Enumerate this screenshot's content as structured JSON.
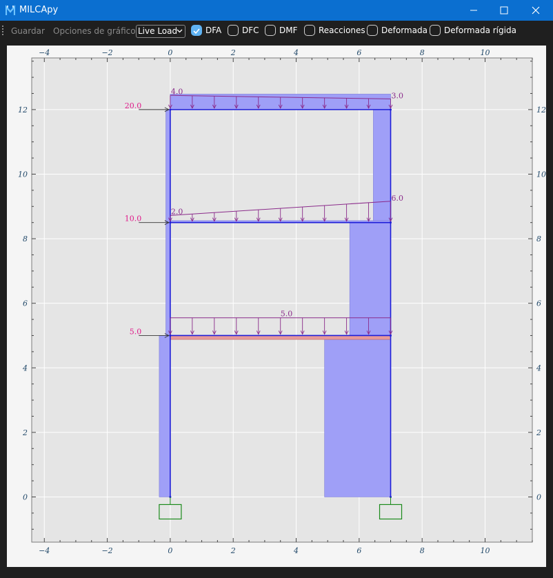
{
  "window": {
    "title": "MILCApy",
    "app_icon": "milca-logo-icon",
    "controls": [
      "minimize-icon",
      "maximize-icon",
      "close-icon"
    ]
  },
  "toolbar": {
    "save_label": "Guardar",
    "chart_options_label": "Opciones de gráfico",
    "load_case": {
      "selected": "Live Load"
    },
    "checkboxes": [
      {
        "label": "DFA",
        "checked": true
      },
      {
        "label": "DFC",
        "checked": false
      },
      {
        "label": "DMF",
        "checked": false
      },
      {
        "label": "Reacciones",
        "checked": false
      },
      {
        "label": "Deformada",
        "checked": false
      },
      {
        "label": "Deformada rígida",
        "checked": false
      }
    ]
  },
  "colors": {
    "titlebar": "#0b6fd0",
    "axial_fill": "#9f9ff7",
    "frame_line": "#1d1dd8",
    "distributed_load": "#8a2a8a",
    "point_load_label": "#e0198a",
    "tension_fill": "#e79a9a",
    "support": "#1a8a1a",
    "plot_background": "#e5e5e5"
  },
  "chart_data": {
    "type": "structural-frame",
    "title": "",
    "xlim": [
      -4.4,
      11.5
    ],
    "ylim": [
      -1.4,
      13.6
    ],
    "xticks": [
      -4,
      -2,
      0,
      2,
      4,
      6,
      8,
      10
    ],
    "yticks": [
      0,
      2,
      4,
      6,
      8,
      10,
      12
    ],
    "grid": true,
    "nodes": [
      [
        0,
        0
      ],
      [
        7,
        0
      ],
      [
        0,
        5
      ],
      [
        7,
        5
      ],
      [
        0,
        8.5
      ],
      [
        7,
        8.5
      ],
      [
        0,
        12
      ],
      [
        7,
        12
      ]
    ],
    "members": [
      [
        [
          0,
          0
        ],
        [
          0,
          5
        ]
      ],
      [
        [
          0,
          5
        ],
        [
          0,
          8.5
        ]
      ],
      [
        [
          0,
          8.5
        ],
        [
          0,
          12
        ]
      ],
      [
        [
          7,
          0
        ],
        [
          7,
          5
        ]
      ],
      [
        [
          7,
          5
        ],
        [
          7,
          8.5
        ]
      ],
      [
        [
          7,
          8.5
        ],
        [
          7,
          12
        ]
      ],
      [
        [
          0,
          5
        ],
        [
          7,
          5
        ]
      ],
      [
        [
          0,
          8.5
        ],
        [
          7,
          8.5
        ]
      ],
      [
        [
          0,
          12
        ],
        [
          7,
          12
        ]
      ]
    ],
    "supports": [
      [
        0,
        0
      ],
      [
        7,
        0
      ]
    ],
    "point_loads": [
      {
        "y": 5,
        "value": "5.0"
      },
      {
        "y": 8.5,
        "value": "10.0"
      },
      {
        "y": 12,
        "value": "20.0"
      }
    ],
    "distributed_loads": [
      {
        "y": 12,
        "x_start": 0,
        "x_end": 7,
        "w_start": 4.0,
        "w_end": 3.0,
        "labels": [
          "4.0",
          "3.0"
        ]
      },
      {
        "y": 8.5,
        "x_start": 0,
        "x_end": 7,
        "w_start": 2.0,
        "w_end": 6.0,
        "labels": [
          "2.0",
          "6.0"
        ]
      },
      {
        "y": 5,
        "x_start": 0,
        "x_end": 7,
        "w_start": 5.0,
        "w_end": 5.0,
        "labels": [
          "5.0"
        ]
      }
    ],
    "axial_force_diagram": [
      {
        "member": "left-column-1",
        "value": -0.35
      },
      {
        "member": "left-column-2",
        "value": -0.14
      },
      {
        "member": "left-column-3",
        "value": -0.14
      },
      {
        "member": "right-column-1",
        "value": -2.1
      },
      {
        "member": "right-column-2",
        "value": -1.3
      },
      {
        "member": "right-column-3",
        "value": -0.55
      },
      {
        "member": "beam-1",
        "value": 0.12
      },
      {
        "member": "beam-2",
        "value": -0.06
      },
      {
        "member": "beam-3",
        "value": -0.48
      }
    ]
  }
}
